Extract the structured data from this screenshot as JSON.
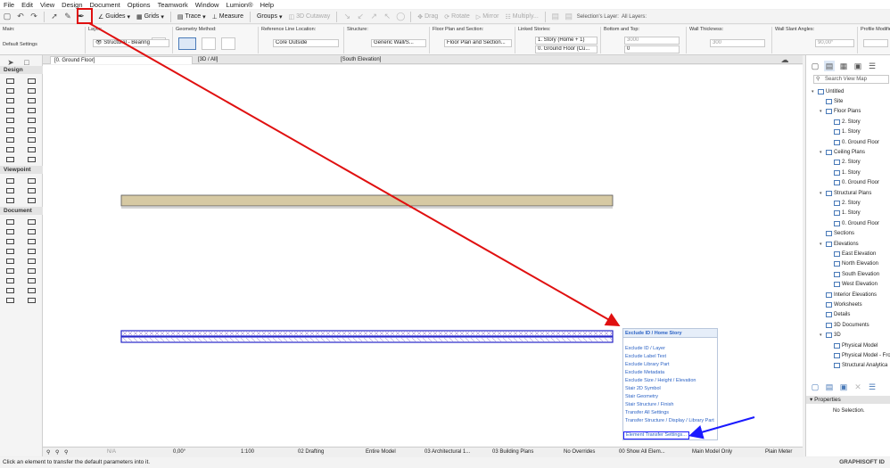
{
  "menu": [
    "File",
    "Edit",
    "View",
    "Design",
    "Document",
    "Options",
    "Teamwork",
    "Window",
    "Lumion®",
    "Help"
  ],
  "toolbar": {
    "guides": "Guides",
    "grids": "Grids",
    "trace": "Trace",
    "measure": "Measure",
    "groups": "Groups",
    "cutaway": "3D Cutaway",
    "drag": "Drag",
    "rotate": "Rotate",
    "mirror": "Mirror",
    "multiply": "Multiply...",
    "selections_layer": "Selection's Layer:",
    "all_layers": "All Layers:"
  },
  "infobox": {
    "main_title": "Main:",
    "main_value": "Default Settings",
    "layer_title": "Layer:",
    "layer_value": "Structural - Bearing",
    "geometry_title": "Geometry Method:",
    "refline_title": "Reference Line Location:",
    "refline_value": "Core Outside",
    "structure_title": "Structure:",
    "structure_value": "Generic Wall/S...",
    "floorplan_title": "Floor Plan and Section:",
    "floorplan_value": "Floor Plan and Section...",
    "linked_title": "Linked Stories:",
    "linked_top": "1. Story (Home + 1)",
    "linked_bottom": "0. Ground Floor (Cu...",
    "bottomtop_title": "Bottom and Top:",
    "bottomtop_top": "3000",
    "bottomtop_bottom": "0",
    "thickness_title": "Wall Thickness:",
    "thickness_value": "300",
    "slant_title": "Wall Slant Angles:",
    "slant_value": "90,00°",
    "profile_title": "Profile Modifier:"
  },
  "tabs": [
    "[0. Ground Floor]",
    "[3D / All]",
    "[South Elevation]"
  ],
  "toolbox": {
    "sections": [
      "Design",
      "Viewpoint",
      "Document"
    ]
  },
  "navigator": {
    "search_placeholder": "Search View Map",
    "tree": [
      {
        "label": "Untitled",
        "level": 0,
        "expanded": true
      },
      {
        "label": "Site",
        "level": 1
      },
      {
        "label": "Floor Plans",
        "level": 1,
        "expanded": true
      },
      {
        "label": "2. Story",
        "level": 2
      },
      {
        "label": "1. Story",
        "level": 2
      },
      {
        "label": "0. Ground Floor",
        "level": 2
      },
      {
        "label": "Ceiling Plans",
        "level": 1,
        "expanded": true
      },
      {
        "label": "2. Story",
        "level": 2
      },
      {
        "label": "1. Story",
        "level": 2
      },
      {
        "label": "0. Ground Floor",
        "level": 2
      },
      {
        "label": "Structural Plans",
        "level": 1,
        "expanded": true
      },
      {
        "label": "2. Story",
        "level": 2
      },
      {
        "label": "1. Story",
        "level": 2
      },
      {
        "label": "0. Ground Floor",
        "level": 2
      },
      {
        "label": "Sections",
        "level": 1
      },
      {
        "label": "Elevations",
        "level": 1,
        "expanded": true
      },
      {
        "label": "East Elevation",
        "level": 2
      },
      {
        "label": "North Elevation",
        "level": 2
      },
      {
        "label": "South Elevation",
        "level": 2
      },
      {
        "label": "West Elevation",
        "level": 2
      },
      {
        "label": "Interior Elevations",
        "level": 1
      },
      {
        "label": "Worksheets",
        "level": 1
      },
      {
        "label": "Details",
        "level": 1
      },
      {
        "label": "3D Documents",
        "level": 1
      },
      {
        "label": "3D",
        "level": 1,
        "expanded": true
      },
      {
        "label": "Physical Model",
        "level": 2
      },
      {
        "label": "Physical Model - Fro",
        "level": 2
      },
      {
        "label": "Structural Analytica",
        "level": 2
      }
    ],
    "properties_title": "Properties",
    "properties_value": "No Selection."
  },
  "popup": {
    "header": "Exclude ID / Home Story",
    "items": [
      "Exclude ID / Layer",
      "Exclude Label Text",
      "Exclude Library Part",
      "Exclude Metadata",
      "Exclude Size / Height / Elevation",
      "Stair 2D Symbol",
      "Stair Geometry",
      "Stair Structure / Finish",
      "Transfer All Settings",
      "Transfer Structure / Display / Library Part"
    ],
    "last": "Element Transfer Settings..."
  },
  "statusbar": {
    "na": "N/A",
    "angle": "0,00°",
    "scale": "1:100",
    "layer_combo": "02 Drafting",
    "model_view": "Entire Model",
    "pen_set": "03 Architectural 1...",
    "mvo": "03 Building Plans",
    "overrides": "No Overrides",
    "renovation": "00 Show All Elem...",
    "structural": "Main Model Only",
    "dimension": "Plain Meter"
  },
  "bottom_message": "Click an element to transfer the default parameters into it.",
  "brand": "GRAPHISOFT ID",
  "colors": {
    "arrow_red": "#e01010",
    "arrow_blue": "#1a1aff",
    "wall_fill": "#d6c9a3",
    "link_blue": "#2c63c5",
    "selected_wall": "#2626c9"
  }
}
